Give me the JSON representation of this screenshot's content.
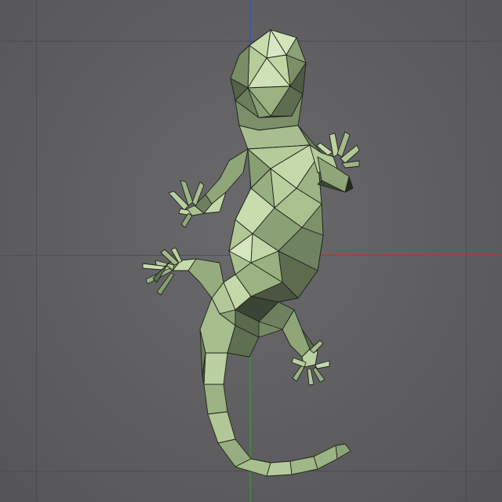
{
  "viewport": {
    "background": "#5d5d5f",
    "grid_color": "#4c4c4e",
    "axis_x_color": "#c0392b",
    "axis_y_color": "#3a9a3a",
    "axis_z_color": "#3b4fd0"
  },
  "model": {
    "name_icon": "low-poly-gecko-mesh",
    "fill_light": "#c9dcae",
    "fill_mid": "#a2b88a",
    "fill_dark": "#5f6f52",
    "fill_shadow": "#2e352a",
    "edge_color": "#1f241c"
  }
}
